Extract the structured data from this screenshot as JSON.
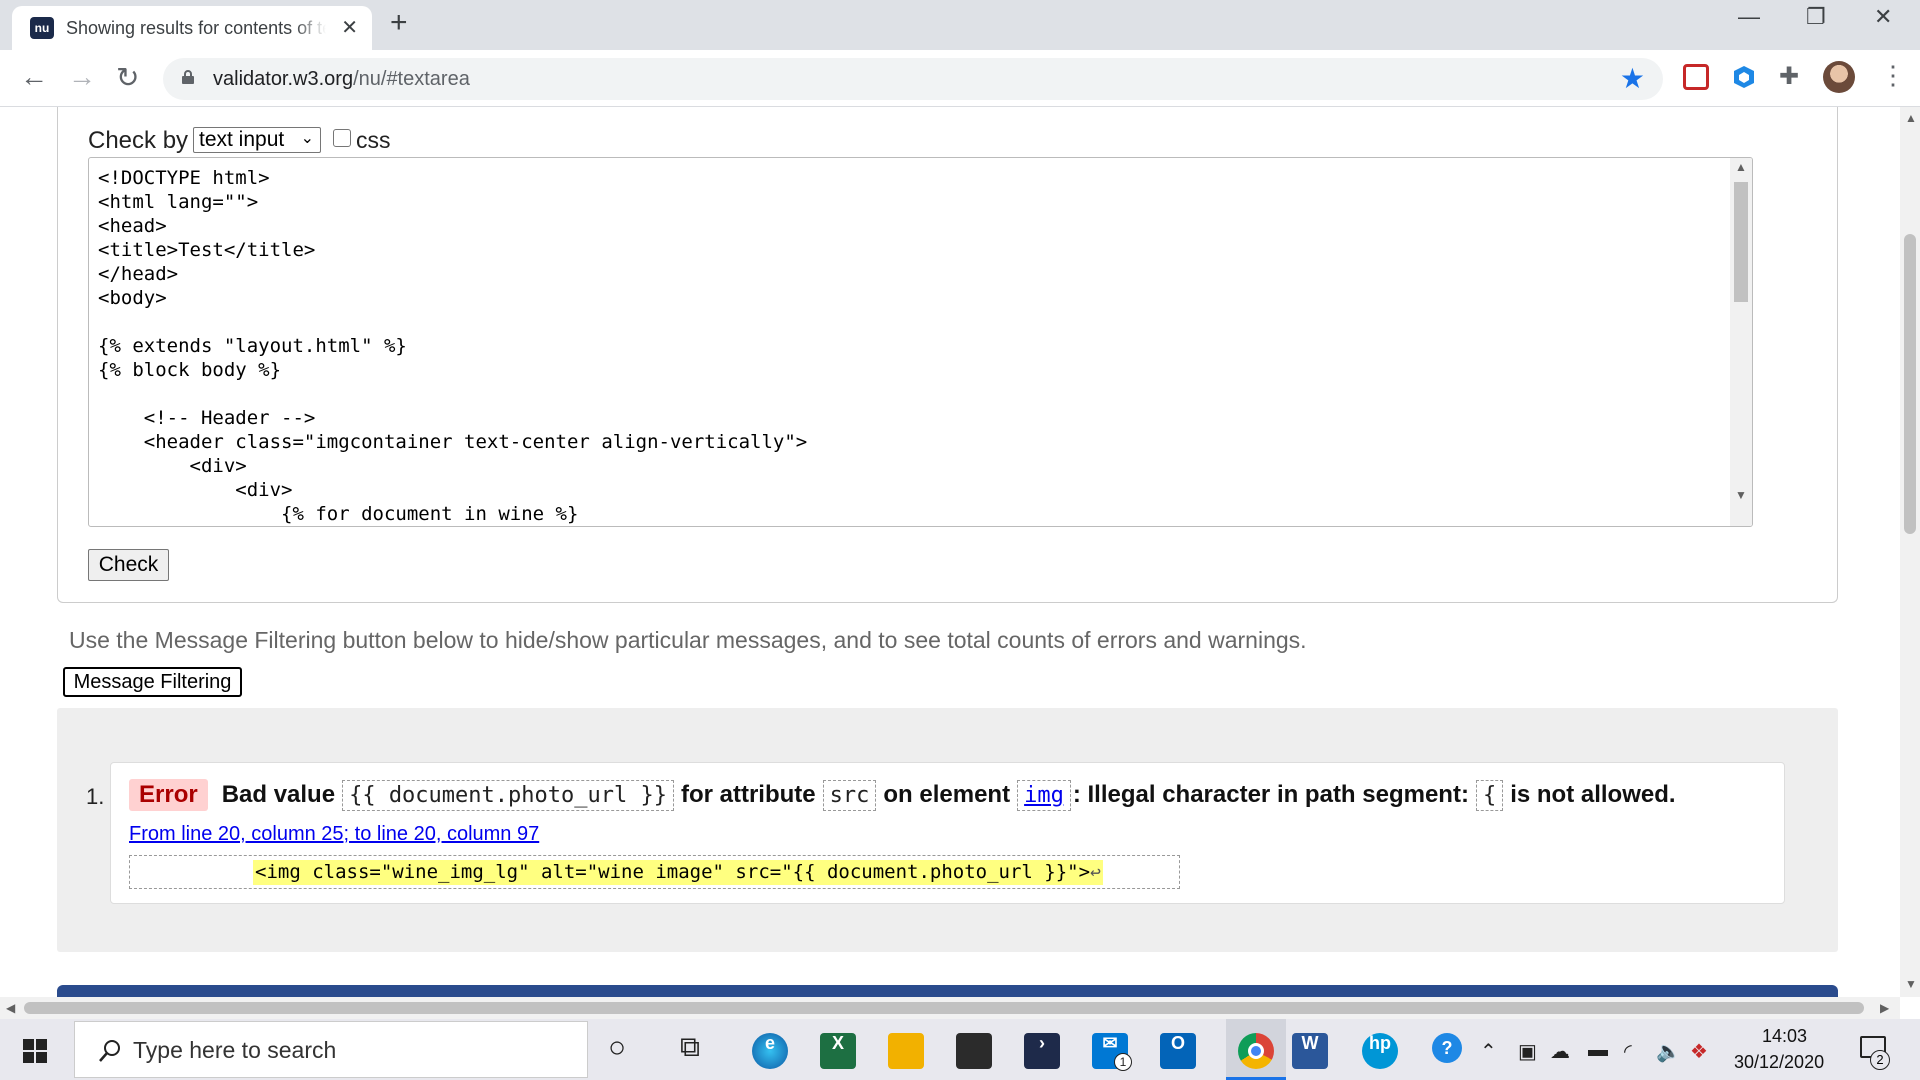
{
  "browser": {
    "tab_title": "Showing results for contents of text-input area",
    "tab_favicon": "nu",
    "url_host": "validator.w3.org",
    "url_path": "/nu/#textarea",
    "win_minimize": "—",
    "win_restore": "❐",
    "win_close": "✕",
    "tab_close": "✕",
    "new_tab": "+",
    "back": "←",
    "forward": "→",
    "reload": "↻",
    "star": "★",
    "menu": "⋮"
  },
  "form": {
    "check_by_label": "Check by",
    "check_by_value": "text input",
    "css_label": "css",
    "textarea_content": "<!DOCTYPE html>\n<html lang=\"\">\n<head>\n<title>Test</title>\n</head>\n<body>\n\n{% extends \"layout.html\" %}\n{% block body %}\n\n    <!-- Header -->\n    <header class=\"imgcontainer text-center align-vertically\">\n        <div>\n            <div>\n                {% for document in wine %}",
    "check_button": "Check"
  },
  "filtering": {
    "note": "Use the Message Filtering button below to hide/show particular messages, and to see total counts of errors and warnings.",
    "button": "Message Filtering"
  },
  "messages": [
    {
      "number": "1.",
      "type": "Error",
      "text_1": "Bad value",
      "value": "{{ document.photo_url }}",
      "text_2": "for attribute",
      "attribute": "src",
      "text_3": "on element",
      "element": "img",
      "text_4": ": Illegal character in path segment:",
      "char": "{",
      "text_5": "is not allowed.",
      "location": "From line 20, column 25; to line 20, column 97",
      "extract": "<img class=\"wine_img_lg\" alt=\"wine image\" src=\"{{ document.photo_url }}\">",
      "extract_return": "↩"
    }
  ],
  "taskbar": {
    "search_placeholder": "Type here to search",
    "time": "14:03",
    "date": "30/12/2020",
    "notification_count": "2",
    "mail_badge": "1"
  },
  "colors": {
    "error_badge_bg": "#ffd1d1",
    "highlight": "#ffff80",
    "link": "#0000ee",
    "accent": "#1a73e8"
  }
}
